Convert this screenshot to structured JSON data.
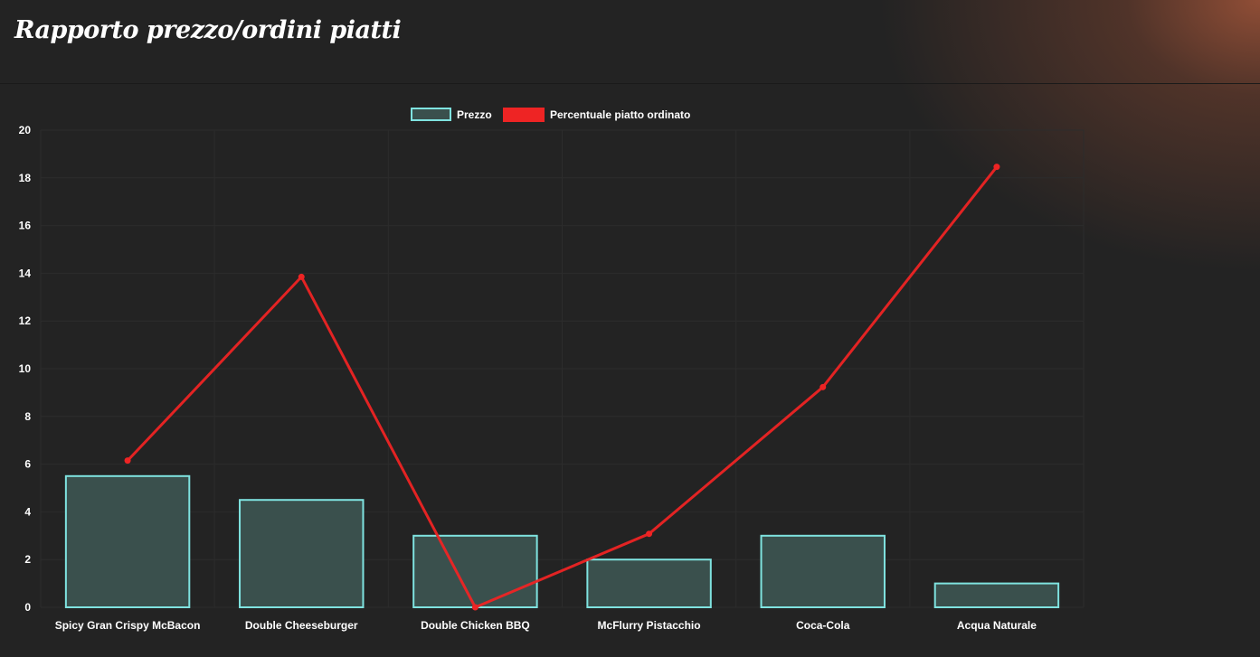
{
  "page": {
    "title": "Rapporto prezzo/ordini piatti"
  },
  "colors": {
    "background": "#232323",
    "bar_fill": "#3a504d",
    "bar_border": "#7fe3e0",
    "line": "#ee2424",
    "grid": "#2c2c2c",
    "text": "#ffffff"
  },
  "chart_data": {
    "type": "bar",
    "title": "",
    "xlabel": "",
    "ylabel": "",
    "ylim": [
      0,
      20
    ],
    "yticks": [
      "0",
      "2",
      "4",
      "6",
      "8",
      "10",
      "12",
      "14",
      "16",
      "18",
      "20"
    ],
    "grid": true,
    "legend_position": "top",
    "categories": [
      "Spicy Gran Crispy McBacon",
      "Double Cheeseburger",
      "Double Chicken BBQ",
      "McFlurry Pistacchio",
      "Coca-Cola",
      "Acqua Naturale"
    ],
    "series": [
      {
        "name": "Prezzo",
        "type": "bar",
        "values": [
          5.5,
          4.5,
          3,
          2,
          3,
          1
        ]
      },
      {
        "name": "Percentuale piatto ordinato",
        "type": "line",
        "values": [
          6.15,
          13.85,
          0,
          3.08,
          9.23,
          18.46
        ]
      }
    ]
  }
}
